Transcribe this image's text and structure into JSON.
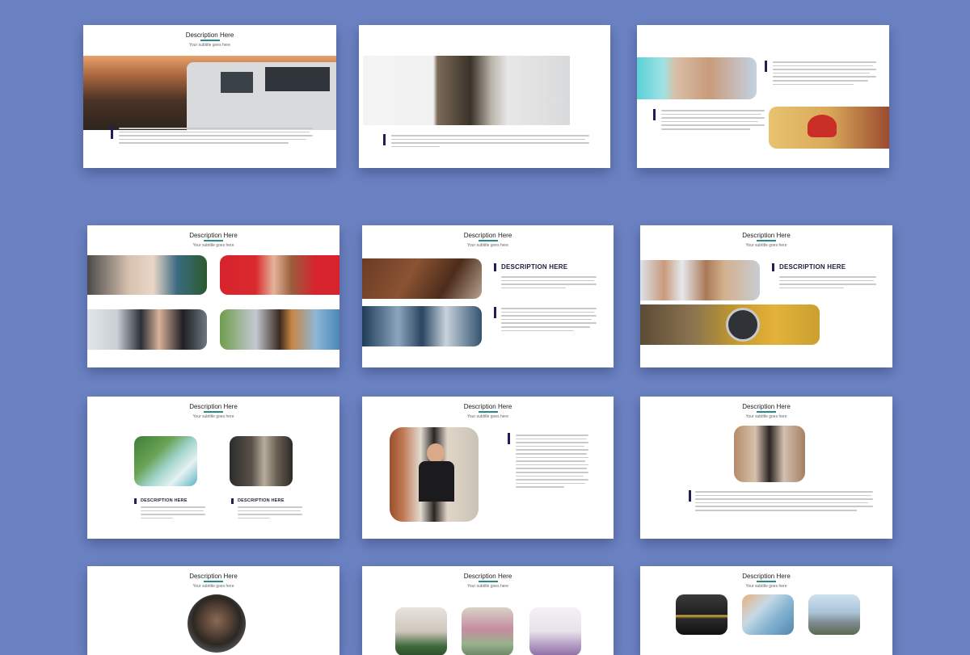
{
  "slide_title": "Description Here",
  "slide_subtitle": "Your subtitle goes here",
  "heading_upper": "DESCRIPTION HERE",
  "colors": {
    "background": "#6b82c2",
    "accent_bar": "#1c1f5c",
    "underline": "#2b8a8a"
  },
  "photos": [
    "car-photo",
    "building-photo",
    "map-photo",
    "cap-photo",
    "woman-photo",
    "woman-red-photo",
    "photographer-photo",
    "violinist-photo",
    "desk-photo",
    "crowd-photo",
    "friends-photo",
    "headlight-photo",
    "island-photo",
    "station-photo",
    "portrait-photo",
    "girl-photo",
    "camera-person-photo",
    "plant-photo",
    "flowers-photo",
    "dessert-photo",
    "cat-photo",
    "ice-photo",
    "mountain-photo"
  ]
}
